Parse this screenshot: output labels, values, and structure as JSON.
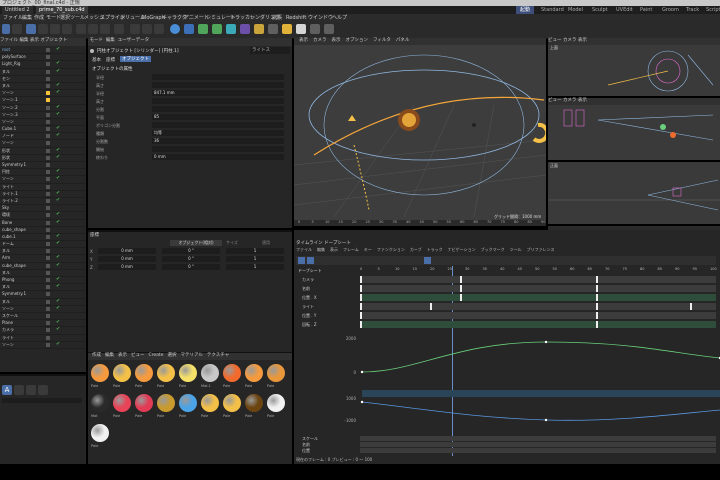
{
  "window": {
    "title": "プロジェクト_00_final.c4d - 正規"
  },
  "tabs": [
    {
      "label": "Untitled 2",
      "active": false
    },
    {
      "label": "prime_70_sub.c4d",
      "active": true
    }
  ],
  "layouts": [
    {
      "label": "起動",
      "active": true
    },
    {
      "label": "Standard",
      "active": false
    },
    {
      "label": "Model",
      "active": false
    },
    {
      "label": "Sculpt",
      "active": false
    },
    {
      "label": "UVEdit",
      "active": false
    },
    {
      "label": "Paint",
      "active": false
    },
    {
      "label": "Groom",
      "active": false
    },
    {
      "label": "Track",
      "active": false
    },
    {
      "label": "Script",
      "active": false
    }
  ],
  "menu": [
    "ファイル",
    "編集",
    "作成",
    "モード",
    "選択",
    "ツール",
    "メッシュ",
    "スプライン",
    "ボリューム",
    "MoGraph",
    "キャラクタ",
    "アニメート",
    "シミュレート",
    "トラッカー",
    "レンダリング",
    "拡張",
    "Redshift",
    "ウインドウ",
    "ヘルプ"
  ],
  "object_manager": {
    "menu": [
      "ファイル",
      "編集",
      "表示",
      "オブジェクト",
      "タグ",
      "ブックマーク"
    ],
    "objects": [
      {
        "name": "root",
        "color": "#7aa9d8"
      },
      {
        "name": "polySurface",
        "color": "#ccc"
      },
      {
        "name": "Light_Rig",
        "color": "#ccc"
      },
      {
        "name": "ヌル",
        "color": "#ccc"
      },
      {
        "name": "セン",
        "color": "#ccc"
      },
      {
        "name": "ヌル",
        "color": "#ccc"
      },
      {
        "name": "ソーン",
        "color": "#ccc"
      },
      {
        "name": "ソーン.1",
        "color": "#ccc"
      },
      {
        "name": "ソーン.2",
        "color": "#ccc"
      },
      {
        "name": "ソーン.3",
        "color": "#ccc"
      },
      {
        "name": "ソーン",
        "color": "#ccc"
      },
      {
        "name": "Cube.1",
        "color": "#ccc"
      },
      {
        "name": "ノード",
        "color": "#ccc"
      },
      {
        "name": "ソーン",
        "color": "#ccc"
      },
      {
        "name": "形状",
        "color": "#ccc"
      },
      {
        "name": "形状",
        "color": "#ccc"
      },
      {
        "name": "Symmetry.1",
        "color": "#ccc"
      },
      {
        "name": "円柱",
        "color": "#ccc"
      },
      {
        "name": "ソーン",
        "color": "#ccc"
      },
      {
        "name": "ライト",
        "color": "#ccc"
      },
      {
        "name": "ライト.1",
        "color": "#ccc"
      },
      {
        "name": "ライト.2",
        "color": "#ccc"
      },
      {
        "name": "Sky",
        "color": "#ccc"
      },
      {
        "name": "環境",
        "color": "#ccc"
      },
      {
        "name": "Bone",
        "color": "#ccc"
      },
      {
        "name": "cube_shape",
        "color": "#ccc"
      },
      {
        "name": "cube.1",
        "color": "#ccc"
      },
      {
        "name": "ドーム",
        "color": "#ccc"
      },
      {
        "name": "ヌル",
        "color": "#ccc"
      },
      {
        "name": "Arm",
        "color": "#ccc"
      },
      {
        "name": "cube_shape",
        "color": "#ccc"
      },
      {
        "name": "ヌル",
        "color": "#ccc"
      },
      {
        "name": "Phong",
        "color": "#ccc"
      },
      {
        "name": "ヌル",
        "color": "#ccc"
      },
      {
        "name": "Symmetry.1",
        "color": "#ccc"
      },
      {
        "name": "ヌル",
        "color": "#ccc"
      },
      {
        "name": "ソーン",
        "color": "#ccc"
      },
      {
        "name": "スケール",
        "color": "#ccc"
      },
      {
        "name": "Plane",
        "color": "#ccc"
      },
      {
        "name": "カメラ",
        "color": "#ccc"
      },
      {
        "name": "ライト",
        "color": "#ccc"
      },
      {
        "name": "ソーン",
        "color": "#ccc"
      }
    ]
  },
  "attributes": {
    "menu": [
      "モード",
      "編集",
      "ユーザーデータ"
    ],
    "object_name": "円柱オブジェクト [シリンダー] [円柱.1]",
    "mode_tabs": [
      "基本",
      "座標",
      "オブジェクト"
    ],
    "section_title": "オブジェクトの属性",
    "fields": [
      {
        "label": "半径",
        "value": ""
      },
      {
        "label": "高さ",
        "value": ""
      },
      {
        "label": "半径",
        "value": "847.1 mm"
      },
      {
        "label": "高さ",
        "value": ""
      },
      {
        "label": "分割",
        "value": ""
      },
      {
        "label": "平面",
        "value": "85"
      },
      {
        "label": "ポリゴン分割",
        "value": ""
      },
      {
        "label": "種類",
        "value": "均等"
      },
      {
        "label": "分割数",
        "value": "36"
      },
      {
        "label": "開始",
        "value": ""
      },
      {
        "label": "終わり",
        "value": "0 mm"
      }
    ],
    "dropdown": "ライトス"
  },
  "coordinates": {
    "title": "座標",
    "header": [
      "オブジェクト(相対)",
      "サイズ",
      "適用"
    ],
    "rows": [
      {
        "axis": "X",
        "pos": "0 mm",
        "rot": "0 °",
        "scale": "1"
      },
      {
        "axis": "Y",
        "pos": "0 mm",
        "rot": "0 °",
        "scale": "1"
      },
      {
        "axis": "Z",
        "pos": "0 mm",
        "rot": "0 °",
        "scale": "1"
      }
    ]
  },
  "materials": {
    "menu": [
      "作成",
      "編集",
      "表示",
      "ビュー",
      "Create",
      "選択",
      "マテリアル",
      "テクスチャ"
    ],
    "items": [
      {
        "label": "Pale",
        "color": "#f59a3e"
      },
      {
        "label": "Pale",
        "color": "#f4c047"
      },
      {
        "label": "Pale",
        "color": "#f59a3e"
      },
      {
        "label": "Pale",
        "color": "#f4c047"
      },
      {
        "label": "Pale",
        "color": "#f5e06a"
      },
      {
        "label": "Mat.1",
        "color": "#c8c8c8"
      },
      {
        "label": "Pale",
        "color": "#f26b2c"
      },
      {
        "label": "Pale",
        "color": "#f59a3e"
      },
      {
        "label": "Pale",
        "color": "#e9973b"
      },
      {
        "label": "Mat",
        "color": "#2a2a2a"
      },
      {
        "label": "Pale",
        "color": "#e84356"
      },
      {
        "label": "Pale",
        "color": "#e23b55"
      },
      {
        "label": "Pale",
        "color": "#c99a2e"
      },
      {
        "label": "Pale",
        "color": "#4ba3e8"
      },
      {
        "label": "Pale",
        "color": "#f4c047"
      },
      {
        "label": "Pale",
        "color": "#f4c047"
      },
      {
        "label": "Pale",
        "color": "#6b4410"
      },
      {
        "label": "Pale",
        "color": "#f2f2f2"
      },
      {
        "label": "Pale",
        "color": "#f2f2f2"
      }
    ]
  },
  "viewport_main": {
    "menu": [
      "表示",
      "カメラ",
      "表示",
      "オプション",
      "フィルタ",
      "パネル"
    ],
    "label": "グリッド間隔：1000 mm",
    "ruler": [
      "0",
      "5",
      "10",
      "15",
      "20",
      "25",
      "30",
      "35",
      "40",
      "45",
      "50",
      "55",
      "60",
      "65",
      "70",
      "75",
      "80",
      "85",
      "90"
    ]
  },
  "viewport_top": {
    "label": "上面",
    "menu": [
      "ビュー",
      "カメラ",
      "表示",
      "オプション",
      "フィルタ",
      "パネル"
    ]
  },
  "viewport_right": {
    "menu": [
      "ビュー",
      "カメラ",
      "表示",
      "オプション",
      "フィルタ",
      "パネル"
    ]
  },
  "viewport_front": {
    "label": "正面"
  },
  "transport": {
    "frame": "100 F",
    "end": "0 F"
  },
  "timeline": {
    "title": "タイムライン ドープシート",
    "menu": [
      "ファイル",
      "編集",
      "表示",
      "フレーム",
      "キー",
      "ファンクション",
      "カーブ",
      "トラック",
      "ナビゲーション",
      "ブックマーク",
      "ツール",
      "プリファレンス"
    ],
    "header": "ドープシート",
    "ticks": [
      "0",
      "5",
      "10",
      "15",
      "20",
      "25",
      "30",
      "35",
      "40",
      "45",
      "50",
      "55",
      "60",
      "65",
      "70",
      "75",
      "80",
      "85",
      "90",
      "95",
      "100"
    ],
    "tracks": [
      "カメラ",
      "名前",
      "位置 . X",
      "ライト",
      "位置 . Y",
      "回転 . Z"
    ],
    "curve_labels": [
      "2000",
      "0",
      "-2000",
      "1000",
      "-1000"
    ],
    "bottom_tracks": [
      "スケール",
      "名前",
      "位置"
    ],
    "status": "現在のフレーム : 0  プレビュー : 0 〜 100"
  },
  "colors": {
    "accent": "#4a6fa8",
    "orange": "#f5a63a",
    "green": "#4caf50",
    "curve_green": "#6ad07b",
    "curve_blue": "#5a96e0"
  }
}
